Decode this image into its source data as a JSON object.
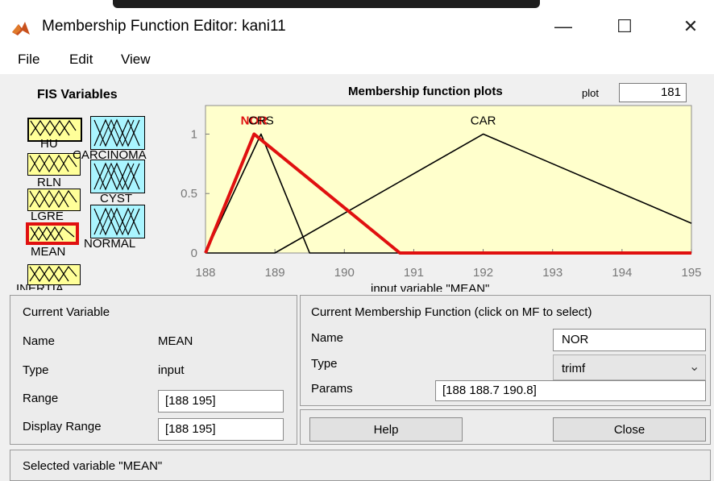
{
  "window": {
    "title": "Membership Function Editor: kani11",
    "minimize_glyph": "—",
    "maximize_glyph": "☐",
    "close_glyph": "✕"
  },
  "menu": [
    "File",
    "Edit",
    "View"
  ],
  "fis_variables": {
    "label": "FIS Variables",
    "inputs": [
      "HU",
      "RLN",
      "LGRE",
      "MEAN",
      "INERTIA"
    ],
    "outputs": [
      "CARCINOMA",
      "CYST",
      "NORMAL"
    ],
    "selected": "MEAN"
  },
  "plot": {
    "title": "Membership function plots",
    "points_label": "plot",
    "points_value": "181",
    "xlabel": "input variable \"MEAN\""
  },
  "chart_data": {
    "type": "line",
    "title": "Membership function plots",
    "xlabel": "input variable \"MEAN\"",
    "xlim": [
      188,
      195
    ],
    "ylim": [
      0,
      1
    ],
    "x_ticks": [
      "188",
      "189",
      "190",
      "191",
      "192",
      "193",
      "194",
      "195"
    ],
    "y_ticks": [
      "0",
      "0.5",
      "1"
    ],
    "background": "#ffffcc",
    "series": [
      {
        "name": "NOR",
        "shape": "trimf",
        "params": [
          188,
          188.7,
          190.8
        ],
        "color": "#e01010",
        "selected": true
      },
      {
        "name": "CRS",
        "shape": "trimf",
        "params": [
          188,
          188.8,
          189.5
        ],
        "color": "#000000",
        "selected": false
      },
      {
        "name": "CAR",
        "shape": "trimf",
        "params": [
          189,
          192,
          196
        ],
        "color": "#000000",
        "selected": false
      }
    ]
  },
  "current_variable": {
    "header": "Current Variable",
    "name_label": "Name",
    "name_value": "MEAN",
    "type_label": "Type",
    "type_value": "input",
    "range_label": "Range",
    "range_value": "[188 195]",
    "display_range_label": "Display Range",
    "display_range_value": "[188 195]"
  },
  "current_mf": {
    "header": "Current Membership Function (click on MF to select)",
    "name_label": "Name",
    "name_value": "NOR",
    "type_label": "Type",
    "type_value": "trimf",
    "params_label": "Params",
    "params_value": "[188 188.7 190.8]"
  },
  "buttons": {
    "help": "Help",
    "close": "Close"
  },
  "status": "Selected variable \"MEAN\""
}
